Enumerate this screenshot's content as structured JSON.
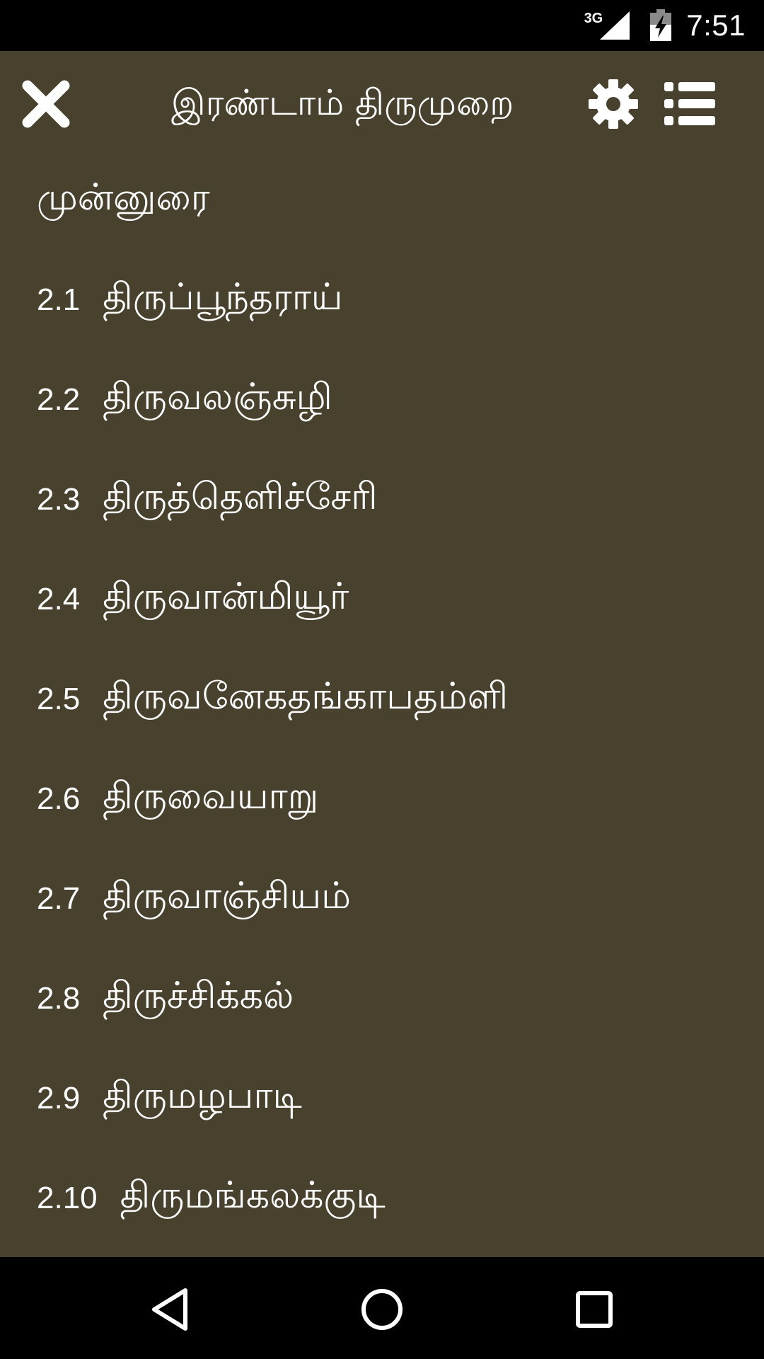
{
  "status_bar": {
    "network_type": "3G",
    "time": "7:51",
    "icons": [
      "signal-icon",
      "battery-charging-icon"
    ]
  },
  "toolbar": {
    "title": "இரண்டாம் திருமுறை",
    "icons": [
      "close-icon",
      "settings-gear-icon",
      "list-menu-icon"
    ]
  },
  "preface": {
    "label": "முன்னுரை"
  },
  "items": [
    {
      "num": "2.1",
      "title": "திருப்பூந்தராய்"
    },
    {
      "num": "2.2",
      "title": "திருவலஞ்சுழி"
    },
    {
      "num": "2.3",
      "title": "திருத்தெளிச்சேரி"
    },
    {
      "num": "2.4",
      "title": "திருவான்மியூர்"
    },
    {
      "num": "2.5",
      "title": "திருவனேகதங்காபதம்ளி"
    },
    {
      "num": "2.6",
      "title": "திருவையாறு"
    },
    {
      "num": "2.7",
      "title": "திருவாஞ்சியம்"
    },
    {
      "num": "2.8",
      "title": "திருச்சிக்கல்"
    },
    {
      "num": "2.9",
      "title": "திருமழபாடி"
    },
    {
      "num": "2.10",
      "title": "திருமங்கலக்குடி"
    }
  ],
  "nav_bar": {
    "icons": [
      "back-icon",
      "home-icon",
      "recents-icon"
    ]
  },
  "colors": {
    "background": "#48412d",
    "text": "#ffffff",
    "bars": "#000000"
  }
}
